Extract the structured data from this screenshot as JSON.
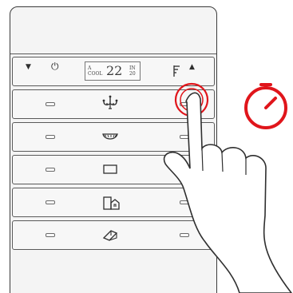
{
  "panel": {
    "display_row": {
      "left_arrow": "▼",
      "power_icon": "⏻",
      "display": {
        "mode_top": "A",
        "mode_bottom": "COOL",
        "temperature": "22",
        "inside_label": "IN",
        "inside_value": "20"
      },
      "fan_icon": "⁌",
      "up_arrow": "▲"
    },
    "rows": [
      {
        "icon": "chandelier-icon"
      },
      {
        "icon": "ceiling-light-icon"
      },
      {
        "icon": "rectangle-icon"
      },
      {
        "icon": "exit-door-icon"
      },
      {
        "icon": "eraser-icon"
      }
    ]
  },
  "overlay": {
    "timer_icon": "timer-icon",
    "touch_indicator": "touch-ring",
    "hand": "pointing-hand"
  },
  "colors": {
    "accent": "#e0151b",
    "panel_border": "#3b3b3b",
    "panel_bg": "#f4f4f4"
  }
}
